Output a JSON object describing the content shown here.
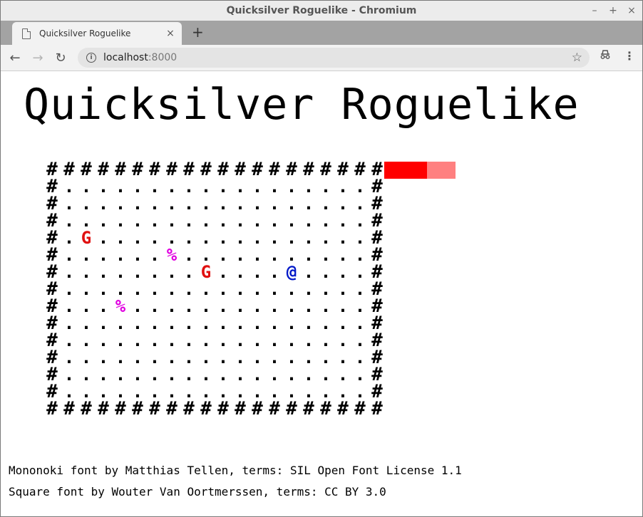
{
  "window": {
    "title": "Quicksilver Roguelike - Chromium",
    "minimize_glyph": "–",
    "maximize_glyph": "+",
    "close_glyph": "×"
  },
  "tab": {
    "title": "Quicksilver Roguelike",
    "close_glyph": "×",
    "new_tab_glyph": "+"
  },
  "toolbar": {
    "back_glyph": "←",
    "forward_glyph": "→",
    "reload_glyph": "↻",
    "url_host": "localhost",
    "url_port": ":8000",
    "star_glyph": "☆",
    "menu_glyph": "⋮"
  },
  "game": {
    "title": "Quicksilver Roguelike",
    "health": {
      "current": 0.6,
      "fill_color": "#ff0000",
      "empty_color": "#ff8080"
    },
    "map": {
      "width": 20,
      "height": 15,
      "wall_glyph": "#",
      "floor_glyph": ".",
      "entities": [
        {
          "kind": "goblin",
          "glyph": "G",
          "col": 2,
          "row": 4,
          "color": "#e01010"
        },
        {
          "kind": "item",
          "glyph": "%",
          "col": 7,
          "row": 5,
          "color": "#e000e0"
        },
        {
          "kind": "goblin",
          "glyph": "G",
          "col": 9,
          "row": 6,
          "color": "#e01010"
        },
        {
          "kind": "player",
          "glyph": "@",
          "col": 14,
          "row": 6,
          "color": "#0018c8"
        },
        {
          "kind": "item",
          "glyph": "%",
          "col": 4,
          "row": 8,
          "color": "#e000e0"
        }
      ]
    }
  },
  "credits": [
    "Mononoki font by Matthias Tellen, terms: SIL Open Font License 1.1",
    "Square font by Wouter Van Oortmerssen, terms: CC BY 3.0"
  ]
}
